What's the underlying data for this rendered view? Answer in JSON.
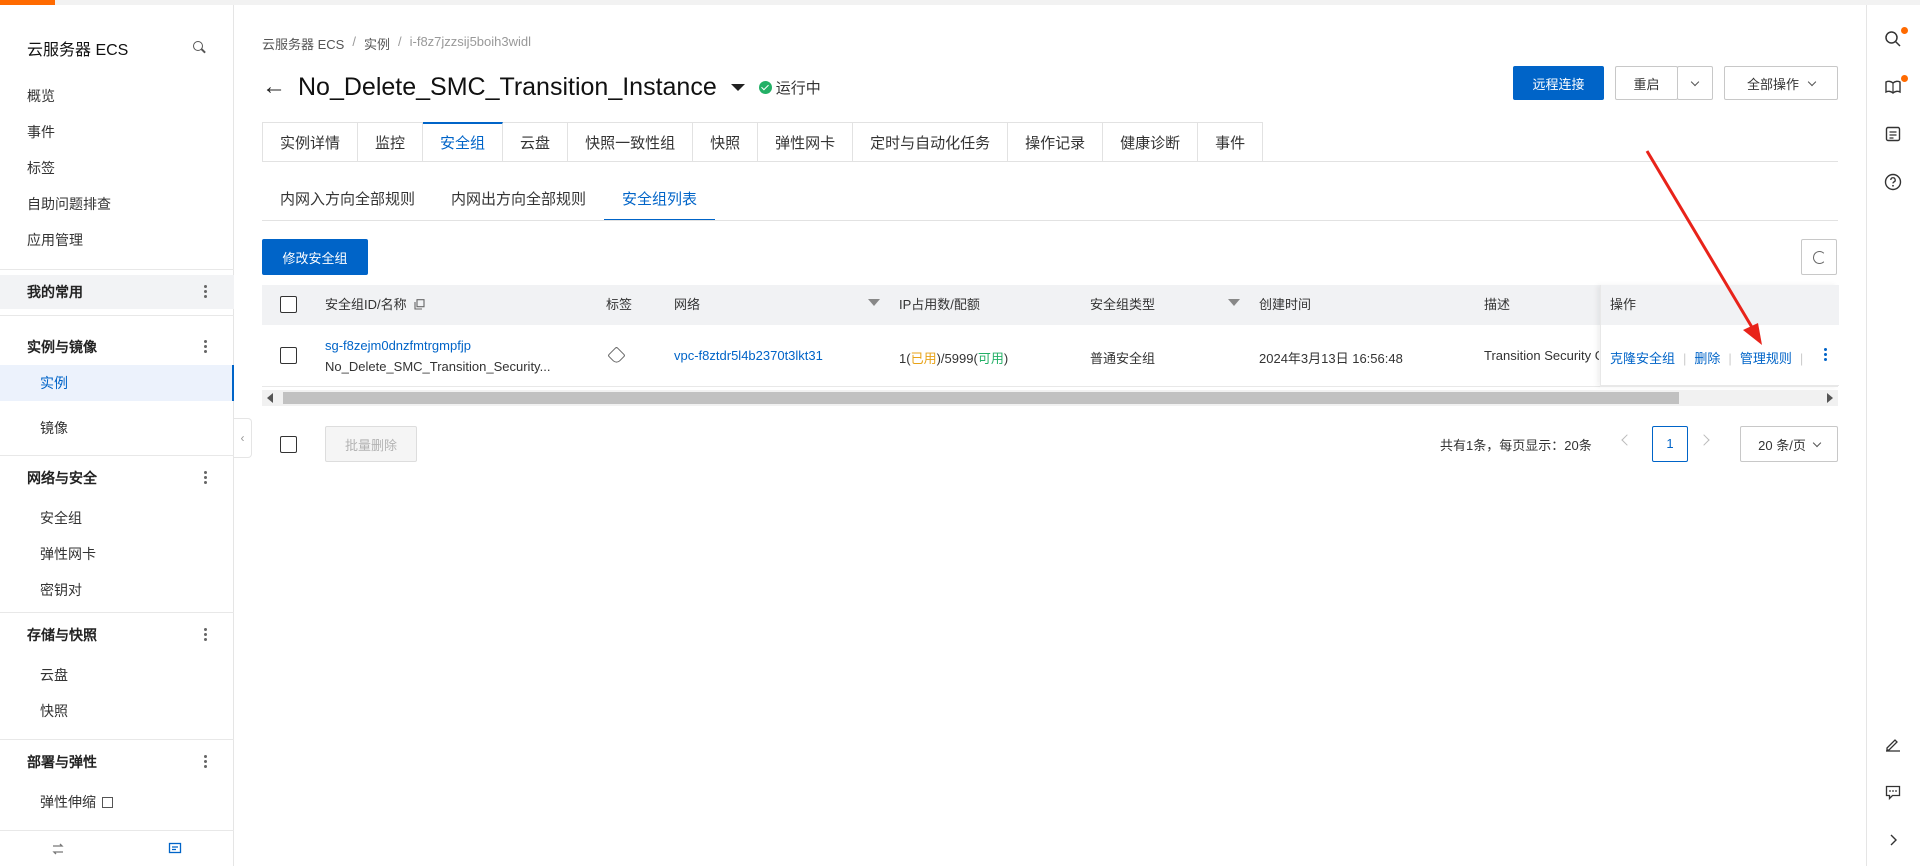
{
  "sidebar": {
    "title": "云服务器 ECS",
    "top_items": [
      "概览",
      "事件",
      "标签",
      "自助问题排查",
      "应用管理"
    ],
    "favorites_label": "我的常用",
    "groups": [
      {
        "label": "实例与镜像",
        "items": [
          "实例",
          "镜像"
        ]
      },
      {
        "label": "网络与安全",
        "items": [
          "安全组",
          "弹性网卡",
          "密钥对"
        ]
      },
      {
        "label": "存储与快照",
        "items": [
          "云盘",
          "快照"
        ]
      },
      {
        "label": "部署与弹性",
        "items": [
          "弹性伸缩"
        ]
      }
    ],
    "active_item": "实例"
  },
  "breadcrumb": [
    "云服务器 ECS",
    "实例",
    "i-f8z7jzzsij5boih3widl"
  ],
  "title": "No_Delete_SMC_Transition_Instance",
  "status": "运行中",
  "actions": {
    "remote": "远程连接",
    "restart": "重启",
    "all": "全部操作"
  },
  "tabs": [
    "实例详情",
    "监控",
    "安全组",
    "云盘",
    "快照一致性组",
    "快照",
    "弹性网卡",
    "定时与自动化任务",
    "操作记录",
    "健康诊断",
    "事件"
  ],
  "active_tab": "安全组",
  "subtabs": [
    "内网入方向全部规则",
    "内网出方向全部规则",
    "安全组列表"
  ],
  "active_subtab": "安全组列表",
  "modify_button": "修改安全组",
  "table": {
    "headers": {
      "id": "安全组ID/名称",
      "tag": "标签",
      "network": "网络",
      "ip": "IP占用数/配额",
      "type": "安全组类型",
      "created": "创建时间",
      "desc": "描述",
      "ops": "操作"
    },
    "rows": [
      {
        "id": "sg-f8zejm0dnzfmtrgmpfjp",
        "name": "No_Delete_SMC_Transition_Security...",
        "network": "vpc-f8ztdr5l4b2370t3lkt31",
        "ip_used": "1",
        "ip_used_label": "已用",
        "ip_quota": "5999",
        "ip_quota_label": "可用",
        "type": "普通安全组",
        "created": "2024年3月13日 16:56:48",
        "desc": "Transition Security G",
        "ops": [
          "克隆安全组",
          "删除",
          "管理规则"
        ]
      }
    ]
  },
  "batch_delete": "批量删除",
  "pager": {
    "total": "共有1条，每页显示：20条",
    "current": "1",
    "page_size": "20 条/页"
  },
  "colors": {
    "primary": "#0064c8",
    "accent": "#ff6a00",
    "success": "#23b066",
    "warning": "#e8a317",
    "annotation": "#e8231a"
  }
}
